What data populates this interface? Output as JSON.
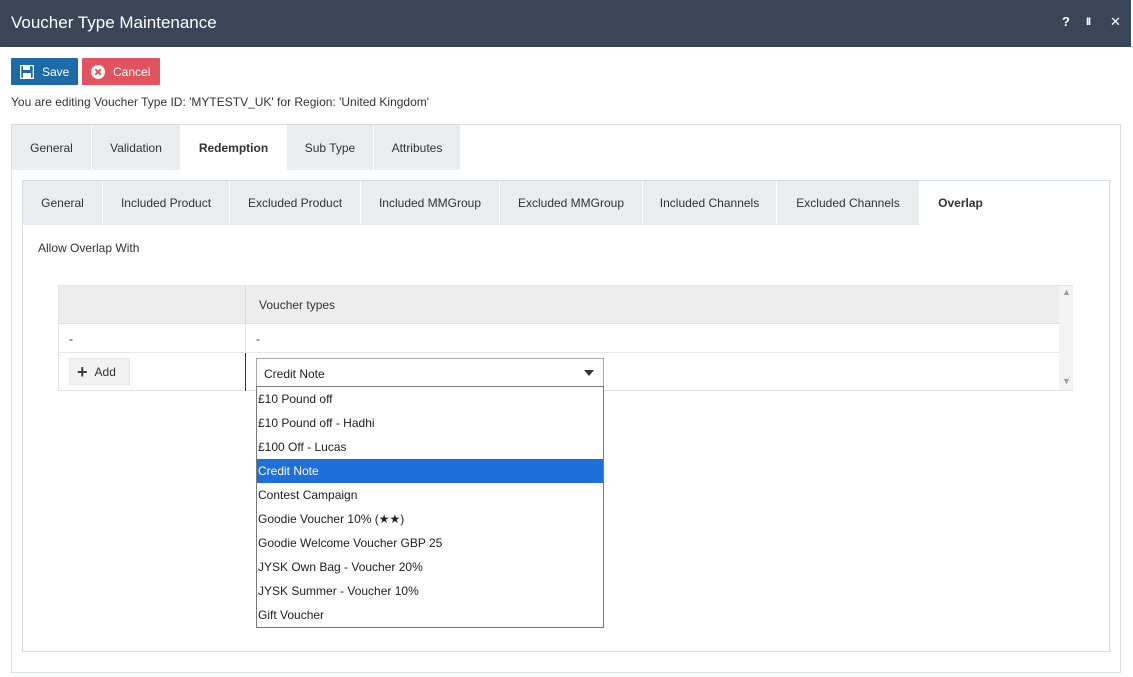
{
  "window": {
    "title": "Voucher Type Maintenance",
    "controls": {
      "help": "?",
      "pause": "II",
      "close": "✕"
    }
  },
  "toolbar": {
    "save_label": "Save",
    "cancel_label": "Cancel",
    "colors": {
      "save": "#1c6aa7",
      "cancel": "#e2525f"
    }
  },
  "editing_text": "You are editing Voucher Type ID: 'MYTESTV_UK' for Region: 'United Kingdom'",
  "main_tabs": [
    {
      "label": "General",
      "active": false
    },
    {
      "label": "Validation",
      "active": false
    },
    {
      "label": "Redemption",
      "active": true
    },
    {
      "label": "Sub Type",
      "active": false
    },
    {
      "label": "Attributes",
      "active": false
    }
  ],
  "sub_tabs": [
    {
      "label": "General",
      "active": false
    },
    {
      "label": "Included Product",
      "active": false
    },
    {
      "label": "Excluded Product",
      "active": false
    },
    {
      "label": "Included MMGroup",
      "active": false
    },
    {
      "label": "Excluded MMGroup",
      "active": false
    },
    {
      "label": "Included Channels",
      "active": false
    },
    {
      "label": "Excluded Channels",
      "active": false
    },
    {
      "label": "Overlap",
      "active": true
    }
  ],
  "overlap": {
    "section_label": "Allow Overlap With",
    "grid": {
      "columns": [
        "",
        "Voucher types"
      ],
      "rows": [
        [
          "-",
          "-"
        ]
      ]
    },
    "add_label": "Add",
    "select": {
      "value": "Credit Note",
      "options": [
        "£10 Pound off",
        "£10 Pound off - Hadhi",
        "£100 Off - Lucas",
        "Credit Note",
        "Contest Campaign",
        "Goodie Voucher 10% (★★)",
        "Goodie Welcome Voucher GBP 25",
        "JYSK Own Bag - Voucher 20%",
        "JYSK Summer - Voucher 10%",
        "Gift Voucher"
      ],
      "highlighted": "Credit Note",
      "highlight_color": "#1e6fd9"
    }
  }
}
